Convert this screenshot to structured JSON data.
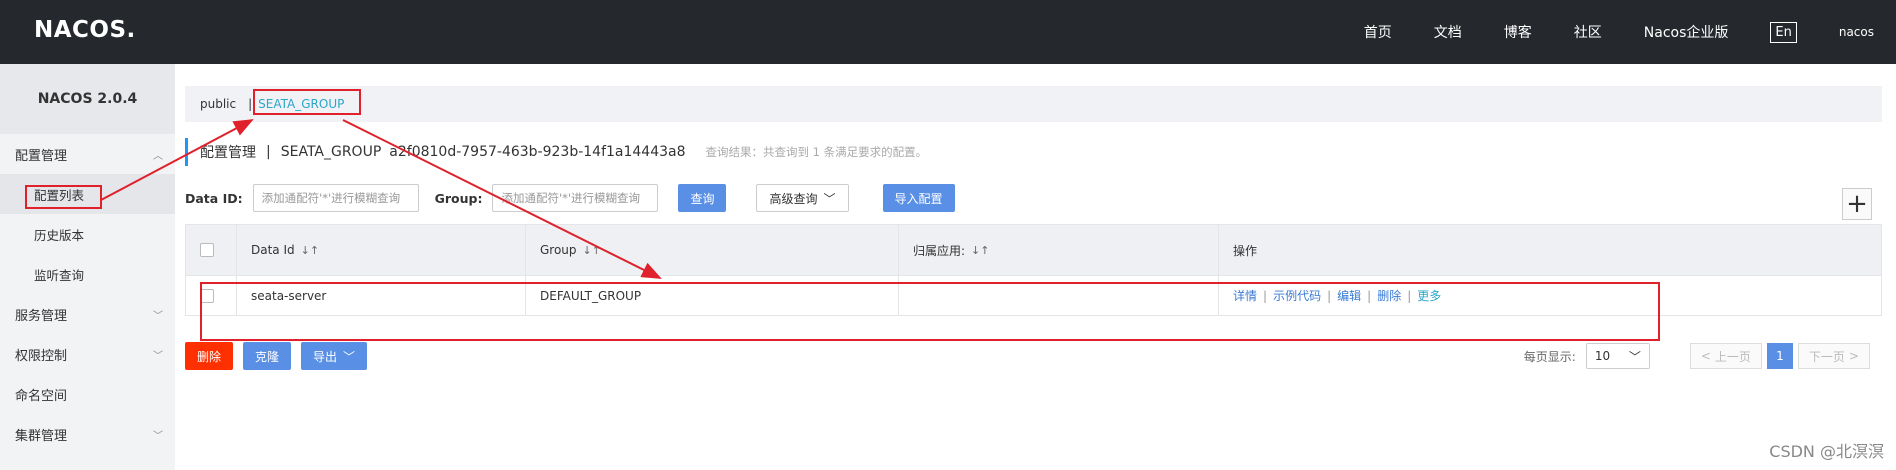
{
  "header": {
    "logo": "NACOS.",
    "nav": [
      "首页",
      "文档",
      "博客",
      "社区",
      "Nacos企业版"
    ],
    "lang": "En",
    "user": "nacos"
  },
  "sidebar": {
    "version": "NACOS 2.0.4",
    "config_group": "配置管理",
    "config_items": [
      "配置列表",
      "历史版本",
      "监听查询"
    ],
    "other_groups": [
      "服务管理",
      "权限控制",
      "命名空间",
      "集群管理"
    ]
  },
  "breadcrumb": {
    "namespace": "public",
    "separator": "|",
    "group": "SEATA_GROUP"
  },
  "title": {
    "label": "配置管理",
    "separator": "|",
    "group": "SEATA_GROUP",
    "tenant": "a2f0810d-7957-463b-923b-14f1a14443a8",
    "result": "查询结果：共查询到 1 条满足要求的配置。"
  },
  "search": {
    "data_id_label": "Data ID:",
    "data_id_placeholder": "添加通配符'*'进行模糊查询",
    "group_label": "Group:",
    "group_placeholder": "添加通配符'*'进行模糊查询",
    "query_button": "查询",
    "advanced_button": "高级查询",
    "import_button": "导入配置",
    "add_button": "+"
  },
  "table": {
    "headers": [
      "Data Id",
      "Group",
      "归属应用:",
      "操作"
    ],
    "rows": [
      {
        "data_id": "seata-server",
        "group": "DEFAULT_GROUP",
        "app": "",
        "ops": [
          "详情",
          "示例代码",
          "编辑",
          "删除",
          "更多"
        ]
      }
    ]
  },
  "actions": {
    "delete": "删除",
    "clone": "克隆",
    "export": "导出"
  },
  "pagination": {
    "page_size_label": "每页显示:",
    "page_size": "10",
    "prev": "上一页",
    "current": "1",
    "next": "下一页"
  },
  "watermark": "CSDN @北溟溟",
  "colors": {
    "header_bg": "#25282d",
    "primary": "#5a8fe6",
    "danger": "#ff3000",
    "annotation": "#e0202a",
    "link": "#3a7bd5"
  }
}
